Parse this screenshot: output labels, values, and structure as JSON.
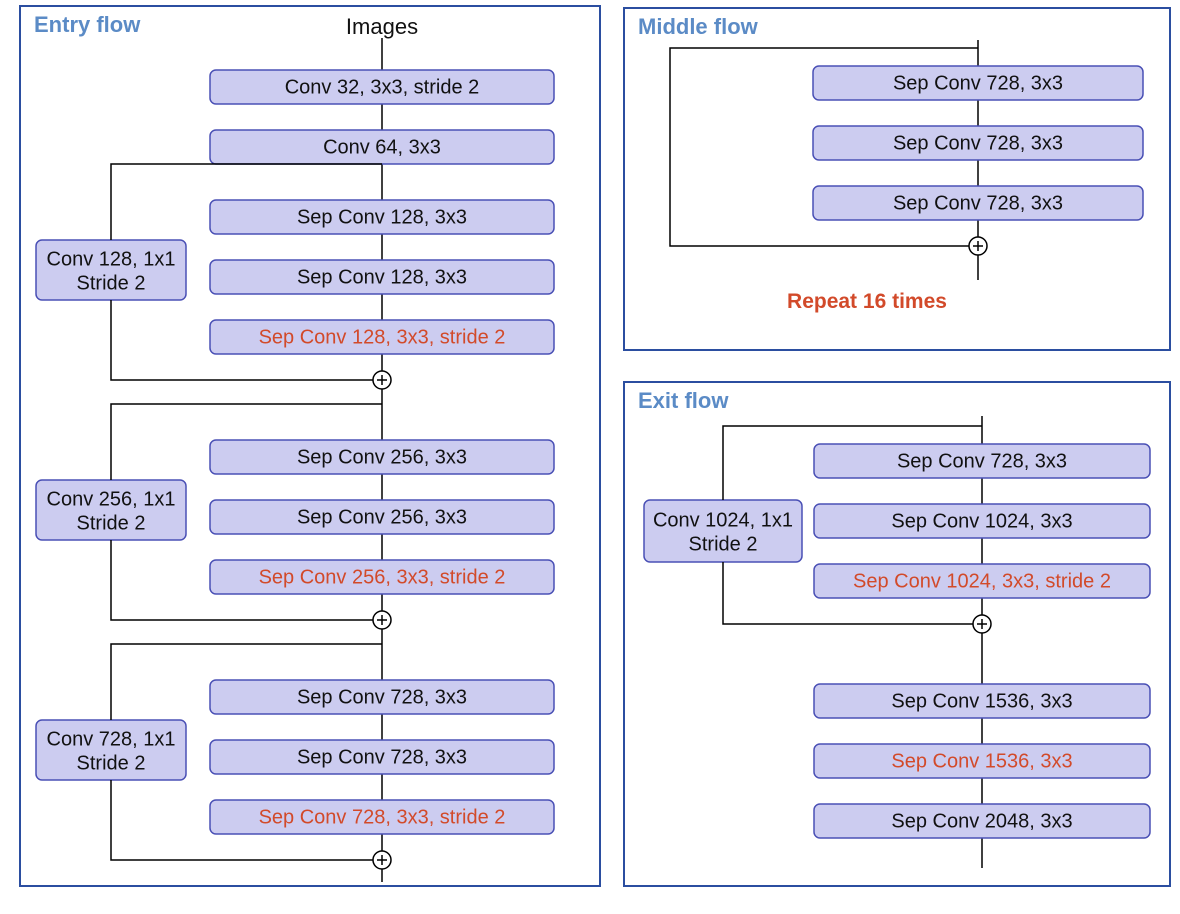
{
  "entry": {
    "title": "Entry  flow",
    "input": "Images",
    "main": [
      {
        "text": "Conv 32, 3x3, stride 2",
        "red": false
      },
      {
        "text": "Conv 64, 3x3",
        "red": false
      },
      {
        "text": "Sep Conv 128, 3x3",
        "red": false
      },
      {
        "text": "Sep Conv 128, 3x3",
        "red": false
      },
      {
        "text": "Sep Conv 128, 3x3, stride 2",
        "red": true
      },
      {
        "text": "Sep Conv 256, 3x3",
        "red": false
      },
      {
        "text": "Sep Conv 256, 3x3",
        "red": false
      },
      {
        "text": "Sep Conv 256, 3x3, stride 2",
        "red": true
      },
      {
        "text": "Sep Conv 728, 3x3",
        "red": false
      },
      {
        "text": "Sep Conv 728, 3x3",
        "red": false
      },
      {
        "text": "Sep Conv 728, 3x3, stride 2",
        "red": true
      }
    ],
    "side": [
      {
        "l1": "Conv 128, 1x1",
        "l2": "Stride 2"
      },
      {
        "l1": "Conv 256, 1x1",
        "l2": "Stride 2"
      },
      {
        "l1": "Conv 728, 1x1",
        "l2": "Stride 2"
      }
    ]
  },
  "middle": {
    "title": "Middle  flow",
    "main": [
      {
        "text": "Sep Conv 728, 3x3",
        "red": false
      },
      {
        "text": "Sep Conv 728, 3x3",
        "red": false
      },
      {
        "text": "Sep Conv 728, 3x3",
        "red": false
      }
    ],
    "repeat": "Repeat 16 times"
  },
  "exit": {
    "title": "Exit  flow",
    "main": [
      {
        "text": "Sep Conv 728, 3x3",
        "red": false
      },
      {
        "text": "Sep Conv 1024, 3x3",
        "red": false
      },
      {
        "text": "Sep Conv 1024, 3x3, stride 2",
        "red": true
      },
      {
        "text": "Sep Conv 1536, 3x3",
        "red": false
      },
      {
        "text": "Sep Conv 1536, 3x3",
        "red": true
      },
      {
        "text": "Sep Conv 2048, 3x3",
        "red": false
      }
    ],
    "side": [
      {
        "l1": "Conv 1024, 1x1",
        "l2": "Stride 2"
      }
    ]
  }
}
